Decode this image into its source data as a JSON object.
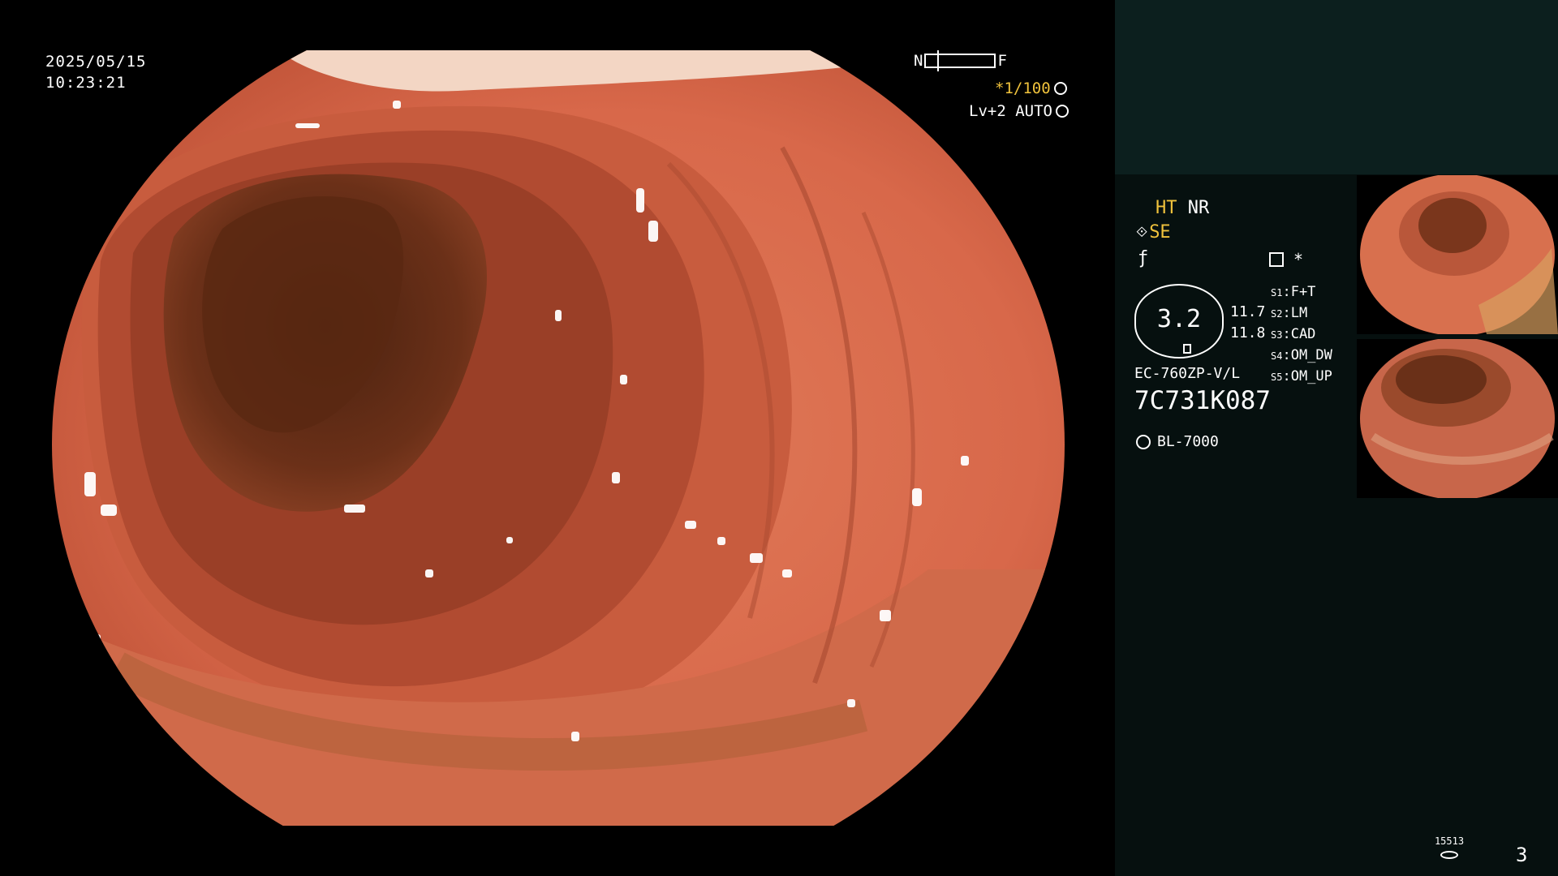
{
  "overlay": {
    "date": "2025/05/15",
    "time": "10:23:21",
    "near_label": "N",
    "far_label": "F",
    "shutter": "*1/100",
    "level": "Lv+2 AUTO"
  },
  "panel": {
    "mode_ht": "HT",
    "mode_nr": "NR",
    "mode_se": "SE",
    "asterisk": "*",
    "zoom_value": "3.2",
    "metric_1": "11.7",
    "metric_2": "11.8",
    "scope_model": "EC-760ZP-V/L",
    "serial": "7C731K087",
    "light_source": "BL-7000",
    "switches": [
      {
        "key": "S1",
        "value": "F+T"
      },
      {
        "key": "S2",
        "value": "LM"
      },
      {
        "key": "S3",
        "value": "CAD"
      },
      {
        "key": "S4",
        "value": "OM_DW"
      },
      {
        "key": "S5",
        "value": "OM_UP"
      }
    ],
    "capture_count": "15513",
    "page_number": "3"
  },
  "icons": [
    "shutter-icon",
    "auto-icon",
    "scope-tip-icon",
    "function-icon",
    "memo-icon",
    "light-source-icon",
    "storage-icon"
  ],
  "colors": {
    "accent": "#f0c23c",
    "panel_bg": "#06100f",
    "panel_top_bg": "#0c1f1e"
  }
}
